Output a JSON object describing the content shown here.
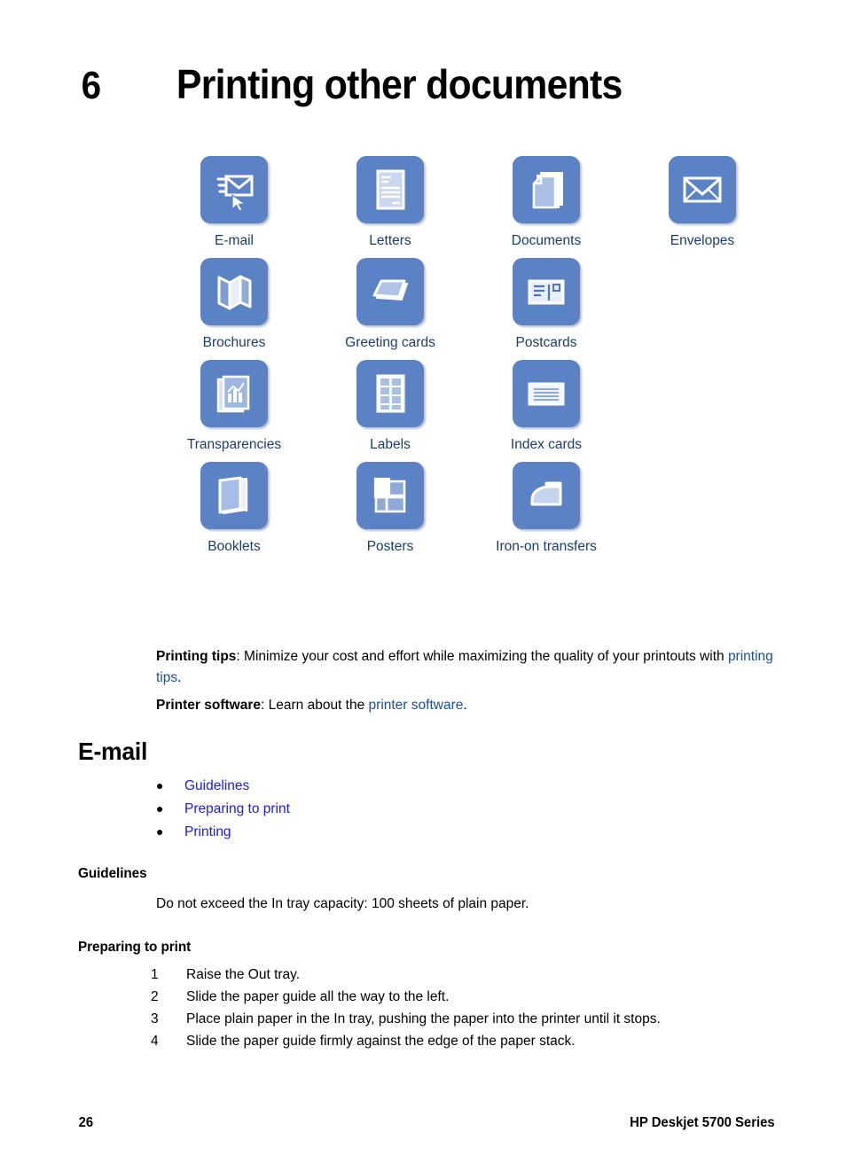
{
  "chapter": {
    "number": "6",
    "title": "Printing other documents"
  },
  "icon_grid": {
    "tile_color": "#5b82c4",
    "label_color": "#1b3d6d",
    "rows": [
      [
        {
          "label": "E-mail",
          "icon": "email-cursor-icon"
        },
        {
          "label": "Letters",
          "icon": "letter-page-icon"
        },
        {
          "label": "Documents",
          "icon": "document-stack-icon"
        },
        {
          "label": "Envelopes",
          "icon": "envelope-icon"
        }
      ],
      [
        {
          "label": "Brochures",
          "icon": "brochure-fold-icon"
        },
        {
          "label": "Greeting cards",
          "icon": "greeting-card-icon"
        },
        {
          "label": "Postcards",
          "icon": "postcard-icon"
        }
      ],
      [
        {
          "label": "Transparencies",
          "icon": "transparency-chart-icon"
        },
        {
          "label": "Labels",
          "icon": "label-sheet-icon"
        },
        {
          "label": "Index cards",
          "icon": "index-card-icon"
        }
      ],
      [
        {
          "label": "Booklets",
          "icon": "booklet-icon"
        },
        {
          "label": "Posters",
          "icon": "poster-tile-icon"
        },
        {
          "label": "Iron-on transfers",
          "icon": "iron-icon"
        }
      ]
    ]
  },
  "tips": {
    "printing_tips_label": "Printing tips",
    "printing_tips_text_1": ": Minimize your cost and effort while maximizing the quality of your printouts with ",
    "printing_tips_link": "printing tips",
    "printing_tips_text_2": ".",
    "printer_software_label": "Printer software",
    "printer_software_text_1": ": Learn about the ",
    "printer_software_link": "printer software",
    "printer_software_text_2": "."
  },
  "email_section": {
    "heading": "E-mail",
    "bullet_marker": "●",
    "links": [
      "Guidelines",
      "Preparing to print",
      "Printing"
    ],
    "guidelines": {
      "heading": "Guidelines",
      "text": "Do not exceed the In tray capacity: 100 sheets of plain paper."
    },
    "preparing": {
      "heading": "Preparing to print",
      "steps": [
        {
          "num": "1",
          "text": "Raise the Out tray."
        },
        {
          "num": "2",
          "text": "Slide the paper guide all the way to the left."
        },
        {
          "num": "3",
          "text": "Place plain paper in the In tray, pushing the paper into the printer until it stops."
        },
        {
          "num": "4",
          "text": "Slide the paper guide firmly against the edge of the paper stack."
        }
      ]
    }
  },
  "footer": {
    "page_number": "26",
    "document_title": "HP Deskjet 5700 Series"
  }
}
